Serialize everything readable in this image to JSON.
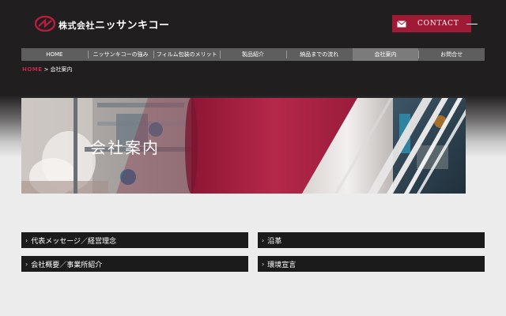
{
  "header": {
    "logo_text": "株式会社",
    "logo_brand": "ニッサンキコー",
    "contact_label": "CONTACT"
  },
  "nav": {
    "items": [
      {
        "label": "HOME"
      },
      {
        "label": "ニッサンキコーの強み"
      },
      {
        "label": "フィルム包装のメリット"
      },
      {
        "label": "製品紹介"
      },
      {
        "label": "納品までの流れ"
      },
      {
        "label": "会社案内",
        "active": true
      },
      {
        "label": "お問合せ"
      }
    ]
  },
  "breadcrumb": {
    "home": "HOME",
    "separator": ">",
    "current": "会社案内"
  },
  "hero": {
    "title": "会社案内"
  },
  "links": [
    {
      "label": "代表メッセージ／経営理念"
    },
    {
      "label": "沿革"
    },
    {
      "label": "会社概要／事業所紹介"
    },
    {
      "label": "環境宣言"
    }
  ],
  "colors": {
    "accent": "#9e1a35",
    "breadcrumb_home": "#c0244a",
    "nav_bg": "#5e5e5e",
    "nav_active": "#7b7b7b",
    "link_bg": "#1b1b1b",
    "header_bg": "#201e1e"
  },
  "icons": {
    "logo": "nissan-kiko-logo-icon",
    "mail": "mail-icon",
    "chevron": "chevron-right-icon"
  }
}
